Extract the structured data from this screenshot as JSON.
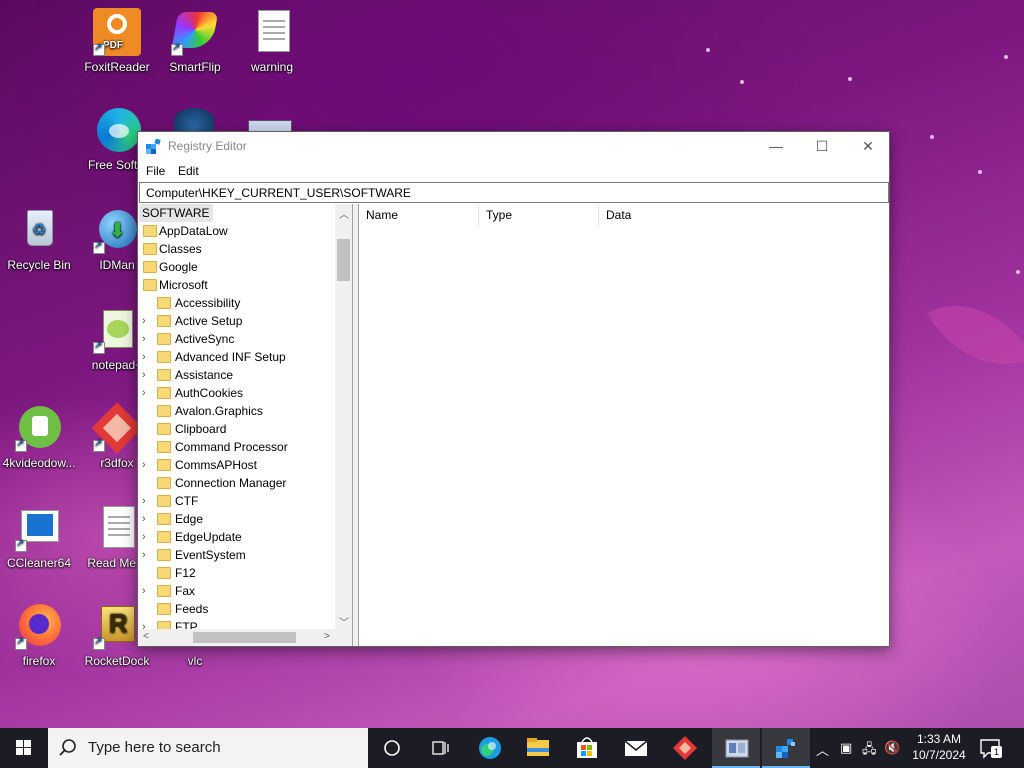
{
  "desktop": {
    "icons": [
      {
        "label": "FoxitReader",
        "icon": "foxit-reader-icon"
      },
      {
        "label": "SmartFlip",
        "icon": "smartflip-icon"
      },
      {
        "label": "warning",
        "icon": "text-file-icon"
      },
      {
        "label": "Free Softw",
        "icon": "edge-icon"
      },
      {
        "label": "Recycle Bin",
        "icon": "recycle-bin-icon"
      },
      {
        "label": "IDMan",
        "icon": "idm-icon"
      },
      {
        "label": "notepad+",
        "icon": "notepad-plus-icon"
      },
      {
        "label": "4kvideodow...",
        "icon": "4k-video-downloader-icon"
      },
      {
        "label": "r3dfox",
        "icon": "r3dfox-icon"
      },
      {
        "label": "CCleaner64",
        "icon": "ccleaner-icon"
      },
      {
        "label": "Read Me F",
        "icon": "text-file-icon"
      },
      {
        "label": "firefox",
        "icon": "firefox-icon"
      },
      {
        "label": "RocketDock",
        "icon": "rocketdock-icon"
      },
      {
        "label": "vlc",
        "icon": "vlc-icon"
      }
    ]
  },
  "window": {
    "title": "Registry Editor",
    "controls": {
      "minimize": "—",
      "maximize": "☐",
      "close": "✕"
    },
    "menu": [
      "File",
      "Edit"
    ],
    "address": "Computer\\HKEY_CURRENT_USER\\SOFTWARE",
    "tree": {
      "root": "SOFTWARE",
      "top_children": [
        "AppDataLow",
        "Classes",
        "Google",
        "Microsoft"
      ],
      "microsoft_children": [
        {
          "label": "Accessibility",
          "expandable": false
        },
        {
          "label": "Active Setup",
          "expandable": true
        },
        {
          "label": "ActiveSync",
          "expandable": true
        },
        {
          "label": "Advanced INF Setup",
          "expandable": true
        },
        {
          "label": "Assistance",
          "expandable": true
        },
        {
          "label": "AuthCookies",
          "expandable": true
        },
        {
          "label": "Avalon.Graphics",
          "expandable": false
        },
        {
          "label": "Clipboard",
          "expandable": false
        },
        {
          "label": "Command Processor",
          "expandable": false
        },
        {
          "label": "CommsAPHost",
          "expandable": true
        },
        {
          "label": "Connection Manager",
          "expandable": false
        },
        {
          "label": "CTF",
          "expandable": true
        },
        {
          "label": "Edge",
          "expandable": true
        },
        {
          "label": "EdgeUpdate",
          "expandable": true
        },
        {
          "label": "EventSystem",
          "expandable": true
        },
        {
          "label": "F12",
          "expandable": false
        },
        {
          "label": "Fax",
          "expandable": true
        },
        {
          "label": "Feeds",
          "expandable": false
        },
        {
          "label": "FTP",
          "expandable": true
        }
      ]
    },
    "columns": [
      "Name",
      "Type",
      "Data"
    ]
  },
  "taskbar": {
    "search_placeholder": "Type here to search",
    "time": "1:33 AM",
    "date": "10/7/2024",
    "notification_count": "1",
    "pinned": [
      "task-view-icon",
      "cortana-icon",
      "edge-icon",
      "file-explorer-icon",
      "store-icon",
      "mail-icon",
      "r3dfox-icon",
      "registry-editor-icon",
      "regedit-blue-icon"
    ]
  }
}
